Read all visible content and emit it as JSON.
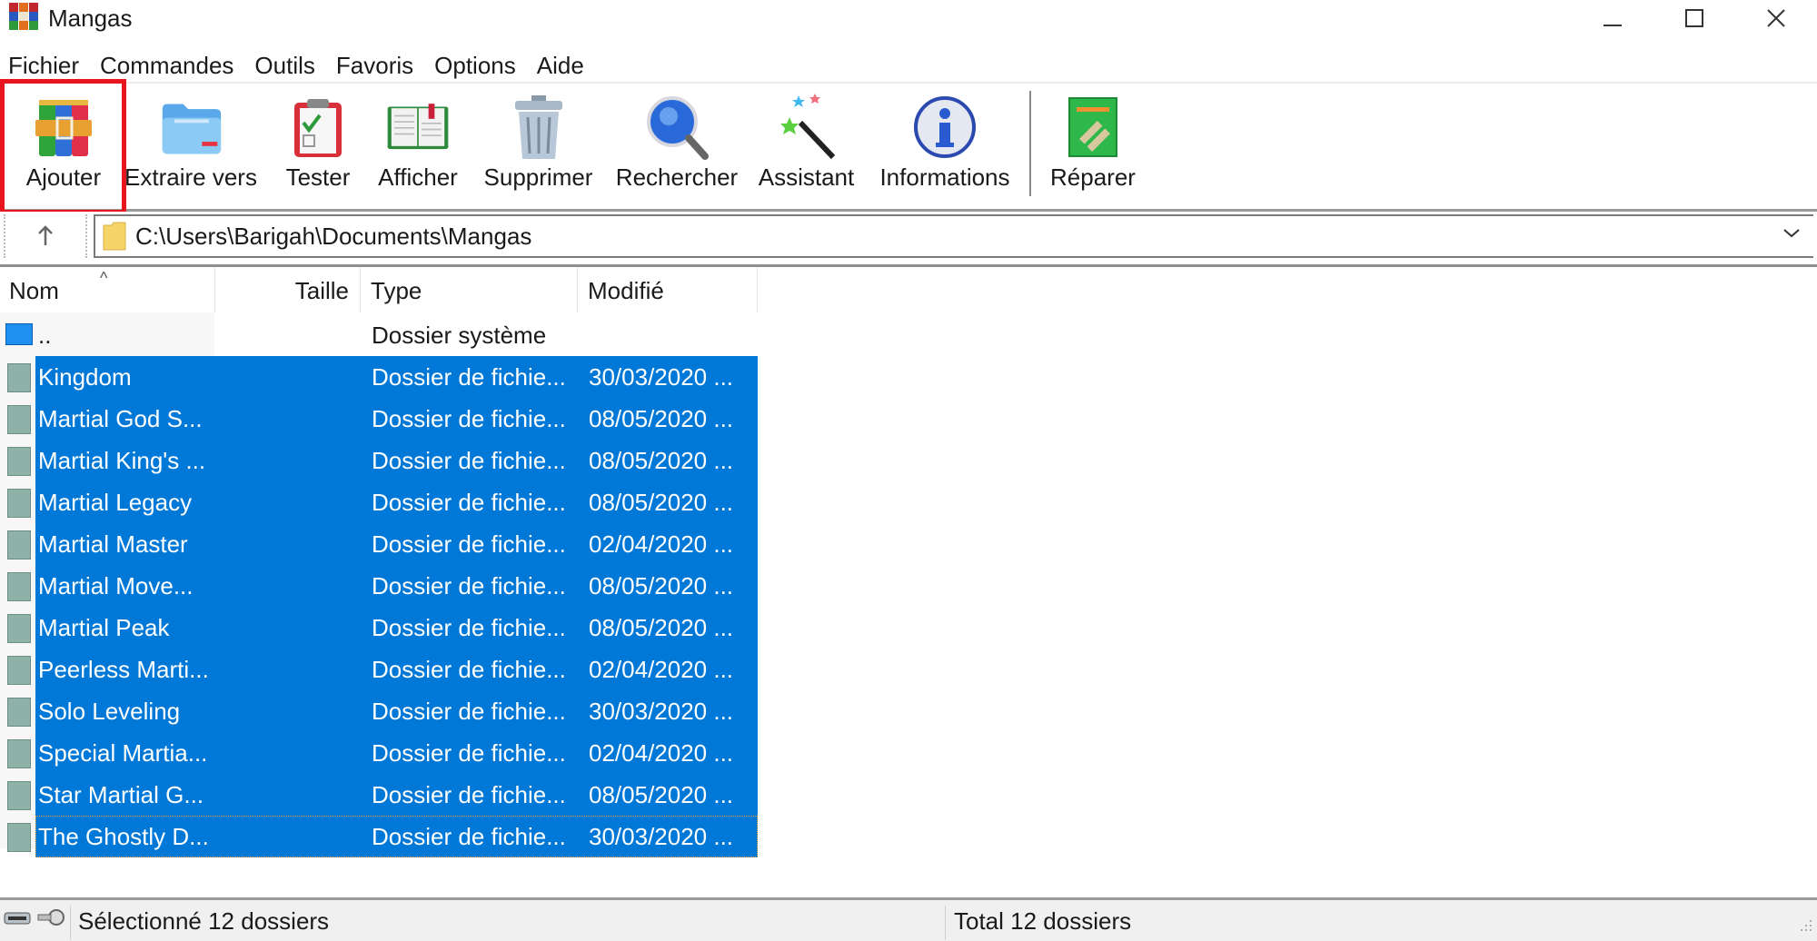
{
  "window": {
    "title": "Mangas",
    "controls": {
      "minimize": "minimize",
      "maximize": "maximize",
      "close": "close"
    }
  },
  "menu": [
    "Fichier",
    "Commandes",
    "Outils",
    "Favoris",
    "Options",
    "Aide"
  ],
  "toolbar": {
    "buttons": [
      {
        "label": "Ajouter",
        "icon": "archive-books-icon",
        "highlighted": true
      },
      {
        "label": "Extraire vers",
        "icon": "folder-extract-icon"
      },
      {
        "label": "Tester",
        "icon": "clipboard-check-icon"
      },
      {
        "label": "Afficher",
        "icon": "open-book-icon"
      },
      {
        "label": "Supprimer",
        "icon": "trash-can-icon"
      },
      {
        "label": "Rechercher",
        "icon": "magnifier-icon"
      },
      {
        "label": "Assistant",
        "icon": "magic-wand-icon"
      },
      {
        "label": "Informations",
        "icon": "info-icon"
      },
      {
        "label": "Réparer",
        "icon": "first-aid-book-icon"
      }
    ],
    "highlight_color": "#e8141e"
  },
  "address": {
    "path": "C:\\Users\\Barigah\\Documents\\Mangas"
  },
  "columns": {
    "name": "Nom",
    "size": "Taille",
    "type": "Type",
    "modified": "Modifié"
  },
  "rows": [
    {
      "name": "..",
      "size": "",
      "type": "Dossier système",
      "modified": "",
      "selected": false
    },
    {
      "name": "Kingdom",
      "size": "",
      "type": "Dossier de fichie...",
      "modified": "30/03/2020 ...",
      "selected": true
    },
    {
      "name": "Martial God S...",
      "size": "",
      "type": "Dossier de fichie...",
      "modified": "08/05/2020 ...",
      "selected": true
    },
    {
      "name": "Martial King's ...",
      "size": "",
      "type": "Dossier de fichie...",
      "modified": "08/05/2020 ...",
      "selected": true
    },
    {
      "name": "Martial Legacy",
      "size": "",
      "type": "Dossier de fichie...",
      "modified": "08/05/2020 ...",
      "selected": true
    },
    {
      "name": "Martial Master",
      "size": "",
      "type": "Dossier de fichie...",
      "modified": "02/04/2020 ...",
      "selected": true
    },
    {
      "name": "Martial Move...",
      "size": "",
      "type": "Dossier de fichie...",
      "modified": "08/05/2020 ...",
      "selected": true
    },
    {
      "name": "Martial Peak",
      "size": "",
      "type": "Dossier de fichie...",
      "modified": "08/05/2020 ...",
      "selected": true
    },
    {
      "name": "Peerless Marti...",
      "size": "",
      "type": "Dossier de fichie...",
      "modified": "02/04/2020 ...",
      "selected": true
    },
    {
      "name": "Solo Leveling",
      "size": "",
      "type": "Dossier de fichie...",
      "modified": "30/03/2020 ...",
      "selected": true
    },
    {
      "name": "Special Martia...",
      "size": "",
      "type": "Dossier de fichie...",
      "modified": "02/04/2020 ...",
      "selected": true
    },
    {
      "name": "Star Martial G...",
      "size": "",
      "type": "Dossier de fichie...",
      "modified": "08/05/2020 ...",
      "selected": true
    },
    {
      "name": "The Ghostly D...",
      "size": "",
      "type": "Dossier de fichie...",
      "modified": "30/03/2020 ...",
      "selected": true,
      "focused": true
    }
  ],
  "selection_color": "#0078d7",
  "status": {
    "left": "Sélectionné 12 dossiers",
    "right": "Total 12 dossiers"
  }
}
